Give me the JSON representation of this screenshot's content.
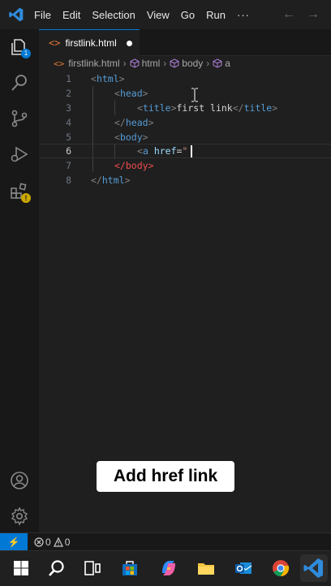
{
  "menu": [
    "File",
    "Edit",
    "Selection",
    "View",
    "Go",
    "Run"
  ],
  "menu_more": "···",
  "nav": {
    "back": "←",
    "forward": "→"
  },
  "activity": {
    "explorer_badge": "1"
  },
  "tab": {
    "filename": "firstlink.html",
    "file_icon": "<>"
  },
  "breadcrumb": {
    "file": "firstlink.html",
    "items": [
      "html",
      "body",
      "a"
    ],
    "sep": "›"
  },
  "editor": {
    "active_line": 6,
    "lines": [
      {
        "n": "1"
      },
      {
        "n": "2"
      },
      {
        "n": "3"
      },
      {
        "n": "4"
      },
      {
        "n": "5"
      },
      {
        "n": "6"
      },
      {
        "n": "7"
      },
      {
        "n": "8"
      }
    ],
    "tokens": {
      "html_tag": "html",
      "head_tag": "head",
      "title_tag": "title",
      "title_text": "first link",
      "body_tag": "body",
      "a_tag": "a",
      "href_attr": "href",
      "eq": "=",
      "quote": "\""
    }
  },
  "caption": "Add href link",
  "status": {
    "errors": "0",
    "warnings": "0",
    "remote_icon": "⚡"
  },
  "colors": {
    "accent": "#0078d4",
    "tag": "#569cd6",
    "attr": "#9cdcfe",
    "string": "#ce9178",
    "html_file": "#e37933"
  }
}
